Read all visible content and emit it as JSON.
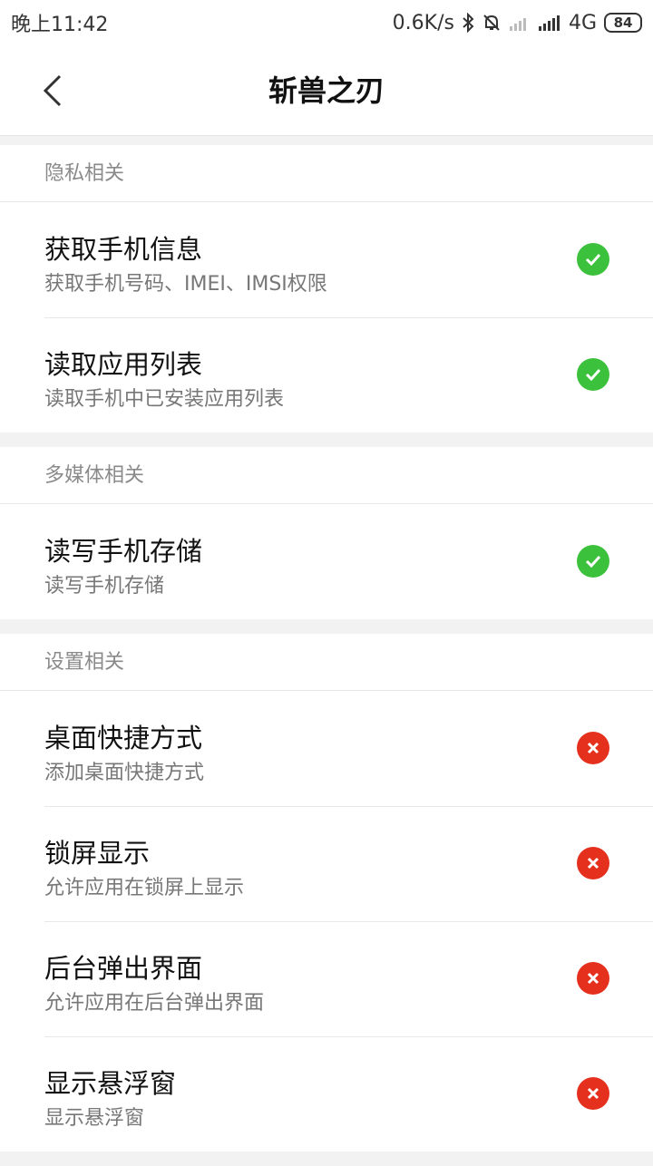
{
  "status_bar": {
    "time": "晚上11:42",
    "network_speed": "0.6K/s",
    "network_type": "4G",
    "battery": "84",
    "icons": [
      "bluetooth-icon",
      "mute-icon",
      "signal-empty-icon",
      "signal-icon"
    ]
  },
  "nav": {
    "title": "斩兽之刃",
    "back_icon": "chevron-left-icon"
  },
  "colors": {
    "allowed": "#3cc13c",
    "denied": "#e5301e"
  },
  "sections": [
    {
      "header": "隐私相关",
      "items": [
        {
          "title": "获取手机信息",
          "desc": "获取手机号码、IMEI、IMSI权限",
          "status": "allowed"
        },
        {
          "title": "读取应用列表",
          "desc": "读取手机中已安装应用列表",
          "status": "allowed"
        }
      ]
    },
    {
      "header": "多媒体相关",
      "items": [
        {
          "title": "读写手机存储",
          "desc": "读写手机存储",
          "status": "allowed"
        }
      ]
    },
    {
      "header": "设置相关",
      "items": [
        {
          "title": "桌面快捷方式",
          "desc": "添加桌面快捷方式",
          "status": "denied"
        },
        {
          "title": "锁屏显示",
          "desc": "允许应用在锁屏上显示",
          "status": "denied"
        },
        {
          "title": "后台弹出界面",
          "desc": "允许应用在后台弹出界面",
          "status": "denied"
        },
        {
          "title": "显示悬浮窗",
          "desc": "显示悬浮窗",
          "status": "denied"
        }
      ]
    }
  ]
}
